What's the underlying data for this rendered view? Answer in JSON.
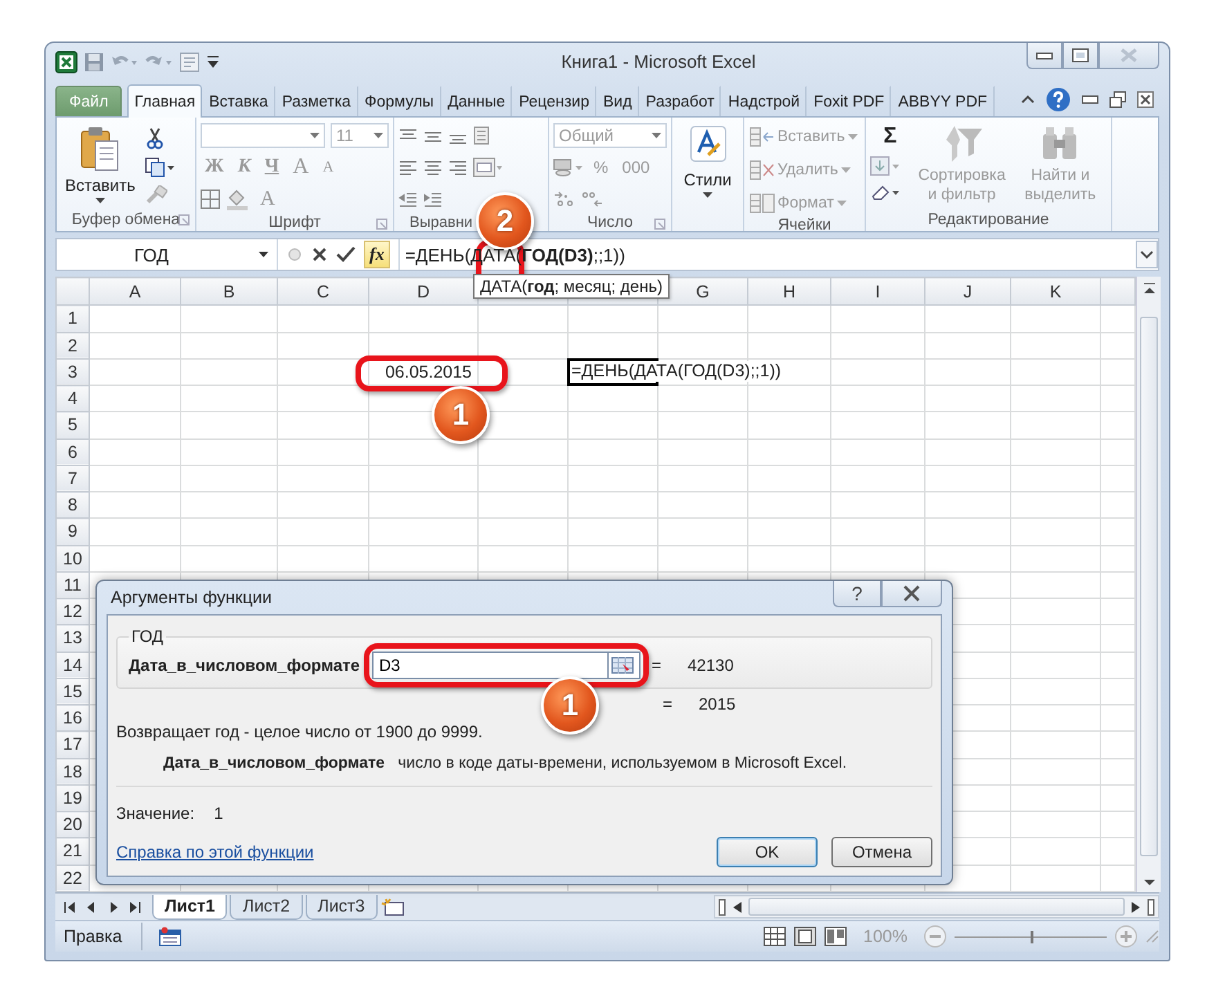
{
  "window": {
    "title": "Книга1 - Microsoft Excel"
  },
  "tabs": [
    {
      "label": "Файл",
      "kind": "file",
      "selected": false
    },
    {
      "label": "Главная",
      "kind": "tab",
      "selected": true
    },
    {
      "label": "Вставка",
      "kind": "tab",
      "selected": false
    },
    {
      "label": "Разметка",
      "kind": "tab",
      "selected": false
    },
    {
      "label": "Формулы",
      "kind": "tab",
      "selected": false
    },
    {
      "label": "Данные",
      "kind": "tab",
      "selected": false
    },
    {
      "label": "Рецензир",
      "kind": "tab",
      "selected": false
    },
    {
      "label": "Вид",
      "kind": "tab",
      "selected": false
    },
    {
      "label": "Разработ",
      "kind": "tab",
      "selected": false
    },
    {
      "label": "Надстрой",
      "kind": "tab",
      "selected": false
    },
    {
      "label": "Foxit PDF",
      "kind": "tab",
      "selected": false
    },
    {
      "label": "ABBYY PDF",
      "kind": "tab",
      "selected": false
    }
  ],
  "ribbon": {
    "clipboard": {
      "paste": "Вставить",
      "label": "Буфер обмена"
    },
    "font": {
      "size": "11",
      "bold": "Ж",
      "italic": "К",
      "underline": "Ч",
      "grow": "A",
      "shrink": "A",
      "font_color_button": "A",
      "label": "Шрифт",
      "disabled": true
    },
    "alignment": {
      "label": "Выравни",
      "disabled": true
    },
    "number": {
      "format": "Общий",
      "percent": "%",
      "thousands": "000",
      "label": "Число",
      "disabled": true
    },
    "styles": {
      "button": "Стили"
    },
    "cells": {
      "buttons": [
        "Вставить",
        "Удалить",
        "Формат"
      ],
      "label": "Ячейки",
      "disabled": true
    },
    "editing": {
      "sum": "Σ",
      "buttons": [
        "Сортировка и фильтр",
        "Найти и выделить"
      ],
      "label": "Редактирование",
      "disabled": true
    }
  },
  "formula_bar": {
    "name_box": "ГОД",
    "function_button": "fx",
    "formula": "=ДЕНЬ(ДАТА(**ГОД(D3)**;;1))",
    "tooltip": "ДАТА(**год**; месяц; день)"
  },
  "sheet": {
    "columns": [
      {
        "label": "A"
      },
      {
        "label": "B"
      },
      {
        "label": "C"
      },
      {
        "label": "D"
      },
      {},
      {},
      {
        "label": "G"
      },
      {
        "label": "H"
      },
      {
        "label": "I"
      },
      {
        "label": "J"
      },
      {
        "label": "K"
      }
    ],
    "rows": [
      "1",
      "2",
      "3",
      "4",
      "5",
      "6",
      "7",
      "8",
      "9",
      "10",
      "11",
      "12",
      "13",
      "14",
      "15",
      "16",
      "17",
      "18",
      "19",
      "20",
      "21",
      "22"
    ],
    "cells": [
      {
        "value": "06.05.2015",
        "active": false
      },
      {
        "value": "=ДЕНЬ(ДАТА(ГОД(D3);;1))",
        "active": true
      }
    ]
  },
  "dialog": {
    "title": "Аргументы функции",
    "help_button": "?",
    "function": "ГОД",
    "argument_label": "Дата_в_числовом_формате",
    "argument_value": "D3",
    "argument_result": {
      "sign": "=",
      "value": "42130"
    },
    "result": {
      "sign": "=",
      "value": "2015"
    },
    "description": "Возвращает год - целое число от 1900 до 9999.",
    "argument_help": "**Дата_в_числовом_формате**   число в коде даты-времени, используемом в Microsoft Excel.",
    "value": {
      "label": "Значение:",
      "value": "1"
    },
    "help_link": "Справка по этой функции",
    "buttons": [
      {
        "label": "OK",
        "default": true
      },
      {
        "label": "Отмена",
        "default": false
      }
    ]
  },
  "annotations": [
    {
      "label": "1"
    },
    {
      "label": "2"
    },
    {
      "label": "1"
    }
  ],
  "sheet_tabs": [
    {
      "label": "Лист1",
      "selected": true
    },
    {
      "label": "Лист2",
      "selected": false
    },
    {
      "label": "Лист3",
      "selected": false
    }
  ],
  "status_bar": {
    "mode": "Правка",
    "zoom": {
      "label": "100%",
      "level": 0.5
    }
  }
}
